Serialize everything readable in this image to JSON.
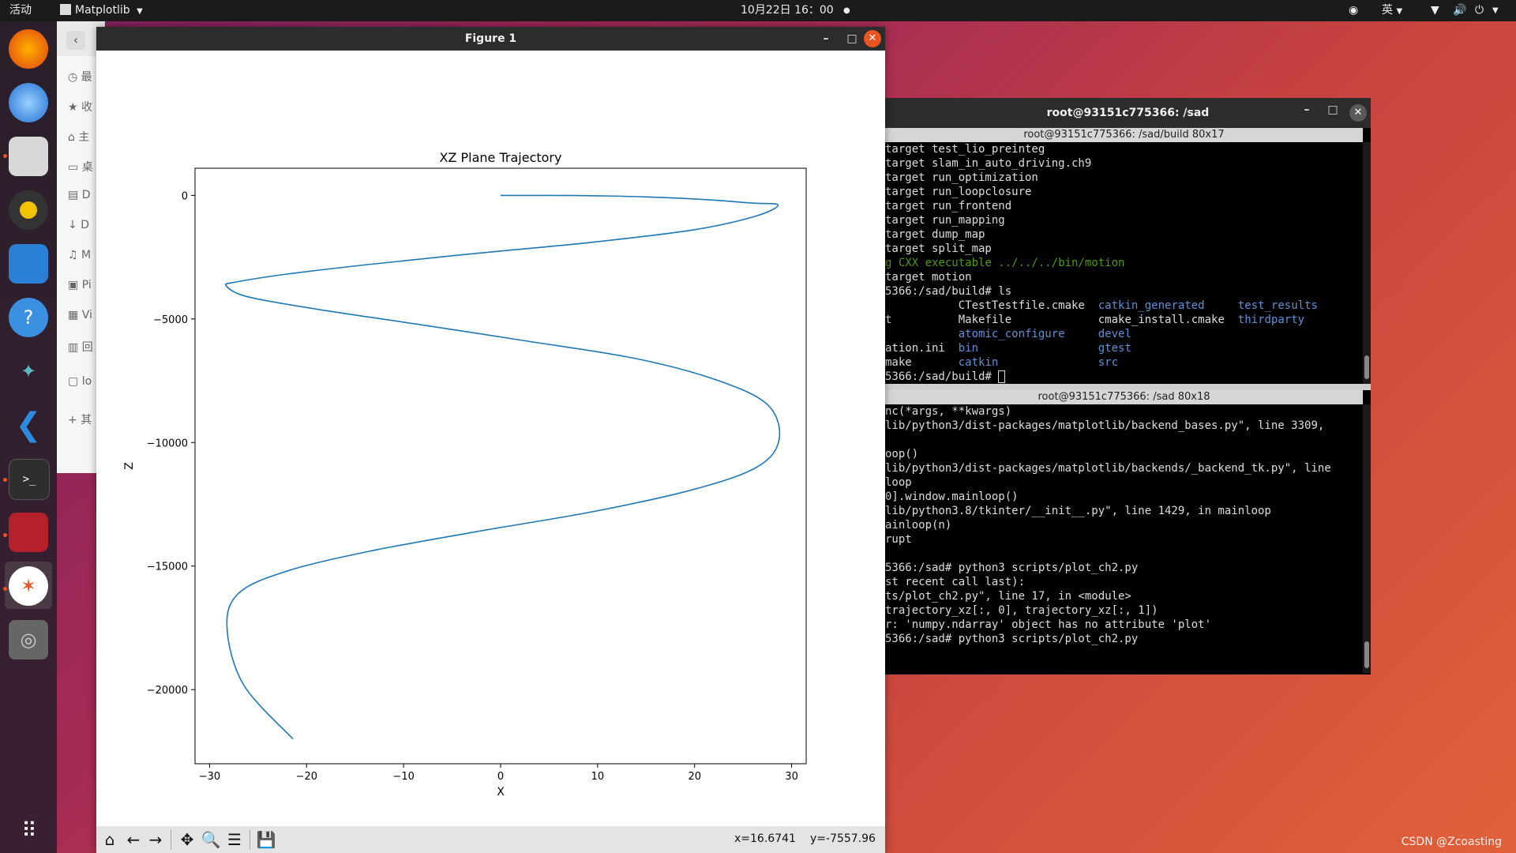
{
  "topbar": {
    "activities": "活动",
    "app_menu": "Matplotlib",
    "datetime": "10月22日 16：00",
    "input_method": "英"
  },
  "dock": {
    "apps": [
      "firefox-icon",
      "thunderbird-icon",
      "files-icon",
      "rhythmbox-icon",
      "writer-icon",
      "help-icon",
      "app-icon",
      "vscode-icon",
      "terminal-icon",
      "app2-icon",
      "app3-icon",
      "disc-icon"
    ],
    "grid_icon": "apps-grid-icon"
  },
  "filemanager": {
    "items": [
      "最",
      "收",
      "主",
      "桌",
      "D",
      "D",
      "M",
      "Pi",
      "Vi",
      "回",
      "lo",
      "其"
    ]
  },
  "figure": {
    "title": "Figure 1",
    "coords_x": "x=16.6741",
    "coords_y": "y=-7557.96"
  },
  "chart_data": {
    "type": "line",
    "title": "XZ Plane Trajectory",
    "xlabel": "X",
    "ylabel": "Z",
    "xlim": [
      -31.5,
      31.5
    ],
    "ylim": [
      -23000,
      1100
    ],
    "xticks": [
      -30,
      -20,
      -10,
      0,
      10,
      20,
      30
    ],
    "xtick_labels": [
      "−30",
      "−20",
      "−10",
      "0",
      "10",
      "20",
      "30"
    ],
    "yticks": [
      0,
      -5000,
      -10000,
      -15000,
      -20000
    ],
    "ytick_labels": [
      "0",
      "−5000",
      "−10000",
      "−15000",
      "−20000"
    ],
    "series": [
      {
        "color": "#1f77b4",
        "x": [
          0.0,
          7.8,
          15.0,
          21.1,
          25.9,
          28.6,
          26.2,
          19.8,
          9.3,
          -2.6,
          -13.7,
          -22.3,
          -27.2,
          -28.3,
          -26.1,
          -19.0,
          -8.8,
          2.8,
          13.9,
          22.5,
          27.6,
          28.7,
          26.4,
          19.9,
          9.5,
          -2.4,
          -13.5,
          -22.0,
          -27.0,
          -28.2,
          -26.5,
          -21.4
        ],
        "y": [
          0,
          -5,
          -60,
          -170,
          -310,
          -390,
          -850,
          -1400,
          -1900,
          -2350,
          -2800,
          -3200,
          -3500,
          -3650,
          -4100,
          -4600,
          -5200,
          -5900,
          -6600,
          -7500,
          -8500,
          -9900,
          -11000,
          -11900,
          -12800,
          -13600,
          -14400,
          -15200,
          -16100,
          -17500,
          -19800,
          -22000
        ]
      }
    ]
  },
  "terminal": {
    "window_title": "root@93151c775366: /sad",
    "pane1_title": "root@93151c775366: /sad/build 80x17",
    "pane2_title": "root@93151c775366: /sad 80x18",
    "pane1_lines": [
      [
        {
          "t": "target test_lio_preinteg",
          "c": "#ddd"
        }
      ],
      [
        {
          "t": "target slam_in_auto_driving.ch9",
          "c": "#ddd"
        }
      ],
      [
        {
          "t": "target run_optimization",
          "c": "#ddd"
        }
      ],
      [
        {
          "t": "target run_loopclosure",
          "c": "#ddd"
        }
      ],
      [
        {
          "t": "target run_frontend",
          "c": "#ddd"
        }
      ],
      [
        {
          "t": "target run_mapping",
          "c": "#ddd"
        }
      ],
      [
        {
          "t": "target dump_map",
          "c": "#ddd"
        }
      ],
      [
        {
          "t": "target split_map",
          "c": "#ddd"
        }
      ],
      [
        {
          "t": "g CXX executable ../../../bin/motion",
          "c": "#4e9a06"
        }
      ],
      [
        {
          "t": "target motion",
          "c": "#ddd"
        }
      ],
      [
        {
          "t": "5366:/sad/build# ls",
          "c": "#ddd"
        }
      ],
      [
        {
          "t": "CTestTestfile.cmake",
          "c": "#ddd",
          "col": 11
        },
        {
          "t": "catkin_generated",
          "c": "#5f8fd6",
          "col": 32
        },
        {
          "t": "test_results",
          "c": "#5f8fd6",
          "col": 53
        }
      ],
      [
        {
          "t": "t",
          "c": "#ddd"
        },
        {
          "t": "Makefile",
          "c": "#ddd",
          "col": 11
        },
        {
          "t": "cmake_install.cmake",
          "c": "#ddd",
          "col": 32
        },
        {
          "t": "thirdparty",
          "c": "#5f8fd6",
          "col": 53
        }
      ],
      [
        {
          "t": "atomic_configure",
          "c": "#5f8fd6",
          "col": 11
        },
        {
          "t": "devel",
          "c": "#5f8fd6",
          "col": 32
        }
      ],
      [
        {
          "t": "ation.ini",
          "c": "#ddd"
        },
        {
          "t": "bin",
          "c": "#5f8fd6",
          "col": 11
        },
        {
          "t": "gtest",
          "c": "#5f8fd6",
          "col": 32
        }
      ],
      [
        {
          "t": "make",
          "c": "#ddd"
        },
        {
          "t": "catkin",
          "c": "#5f8fd6",
          "col": 11
        },
        {
          "t": "src",
          "c": "#5f8fd6",
          "col": 32
        }
      ],
      [
        {
          "t": "5366:/sad/build# ",
          "c": "#ddd"
        }
      ]
    ],
    "pane2_lines": [
      [
        {
          "t": "nc(*args, **kwargs)",
          "c": "#ddd"
        }
      ],
      [
        {
          "t": "lib/python3/dist-packages/matplotlib/backend_bases.py\", line 3309,",
          "c": "#ddd"
        }
      ],
      [
        {
          "t": "",
          "c": "#ddd"
        }
      ],
      [
        {
          "t": "oop()",
          "c": "#ddd"
        }
      ],
      [
        {
          "t": "lib/python3/dist-packages/matplotlib/backends/_backend_tk.py\", line",
          "c": "#ddd"
        }
      ],
      [
        {
          "t": "loop",
          "c": "#ddd"
        }
      ],
      [
        {
          "t": "0].window.mainloop()",
          "c": "#ddd"
        }
      ],
      [
        {
          "t": "lib/python3.8/tkinter/__init__.py\", line 1429, in mainloop",
          "c": "#ddd"
        }
      ],
      [
        {
          "t": "ainloop(n)",
          "c": "#ddd"
        }
      ],
      [
        {
          "t": "rupt",
          "c": "#ddd"
        }
      ],
      [
        {
          "t": "",
          "c": "#ddd"
        }
      ],
      [
        {
          "t": "5366:/sad# python3 scripts/plot_ch2.py",
          "c": "#ddd"
        }
      ],
      [
        {
          "t": "st recent call last):",
          "c": "#ddd"
        }
      ],
      [
        {
          "t": "ts/plot_ch2.py\", line 17, in <module>",
          "c": "#ddd"
        }
      ],
      [
        {
          "t": "trajectory_xz[:, 0], trajectory_xz[:, 1])",
          "c": "#ddd"
        }
      ],
      [
        {
          "t": "r: 'numpy.ndarray' object has no attribute 'plot'",
          "c": "#ddd"
        }
      ],
      [
        {
          "t": "5366:/sad# python3 scripts/plot_ch2.py",
          "c": "#ddd"
        }
      ]
    ]
  },
  "watermark": "CSDN @Zcoasting"
}
